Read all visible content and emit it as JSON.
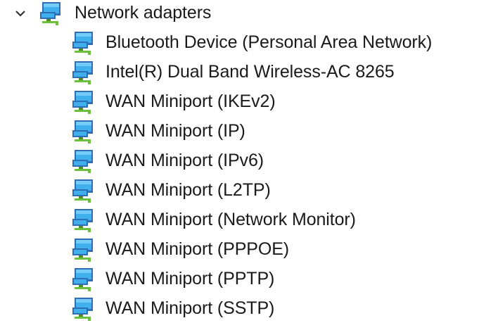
{
  "category": {
    "label": "Network adapters",
    "icon": "network-adapter-icon",
    "expanded": true
  },
  "devices": [
    {
      "label": "Bluetooth Device (Personal Area Network)",
      "icon": "network-adapter-icon"
    },
    {
      "label": "Intel(R) Dual Band Wireless-AC 8265",
      "icon": "network-adapter-icon"
    },
    {
      "label": "WAN Miniport (IKEv2)",
      "icon": "network-adapter-icon"
    },
    {
      "label": "WAN Miniport (IP)",
      "icon": "network-adapter-icon"
    },
    {
      "label": "WAN Miniport (IPv6)",
      "icon": "network-adapter-icon"
    },
    {
      "label": "WAN Miniport (L2TP)",
      "icon": "network-adapter-icon"
    },
    {
      "label": "WAN Miniport (Network Monitor)",
      "icon": "network-adapter-icon"
    },
    {
      "label": "WAN Miniport (PPPOE)",
      "icon": "network-adapter-icon"
    },
    {
      "label": "WAN Miniport (PPTP)",
      "icon": "network-adapter-icon"
    },
    {
      "label": "WAN Miniport (SSTP)",
      "icon": "network-adapter-icon"
    }
  ],
  "colors": {
    "monitor_frame": "#2f6db5",
    "screen": "#3fb0ec",
    "screen_highlight": "#8fd8ff",
    "stand": "#4e8c2a",
    "cable": "#6bbf3a",
    "expander": "#333333",
    "text": "#1a1a1a"
  }
}
